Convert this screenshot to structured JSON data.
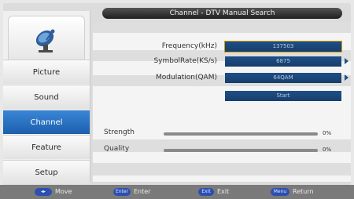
{
  "title": "Channel - DTV Manual Search",
  "sidebar": {
    "logo_icon": "satellite-dish-icon",
    "items": [
      {
        "label": "Picture",
        "active": false
      },
      {
        "label": "Sound",
        "active": false
      },
      {
        "label": "Channel",
        "active": true
      },
      {
        "label": "Feature",
        "active": false
      },
      {
        "label": "Setup",
        "active": false
      }
    ]
  },
  "form": {
    "frequency": {
      "label": "Frequency(kHz)",
      "value": "137503"
    },
    "symbol_rate": {
      "label": "SymbolRate(KS/s)",
      "value": "6875"
    },
    "modulation": {
      "label": "Modulation(QAM)",
      "value": "64QAM"
    },
    "start_label": "Start"
  },
  "signal": {
    "strength": {
      "label": "Strength",
      "value": "0%"
    },
    "quality": {
      "label": "Quality",
      "value": "0%"
    }
  },
  "footer": {
    "move_key": "◂▸",
    "move_label": "Move",
    "enter_key": "Enter",
    "enter_label": "Enter",
    "exit_key": "Exit",
    "exit_label": "Exit",
    "menu_key": "Menu",
    "menu_label": "Return"
  }
}
